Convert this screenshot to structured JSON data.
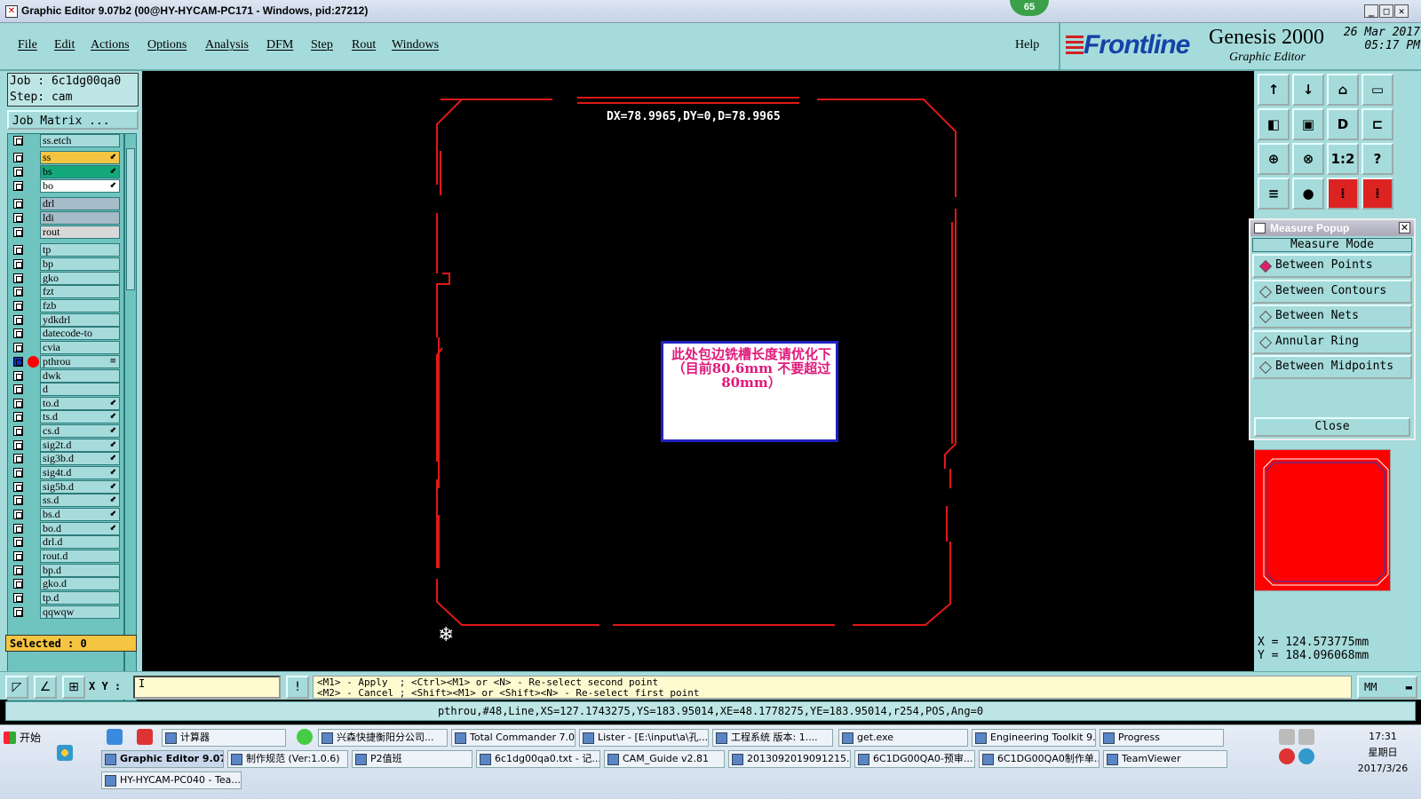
{
  "window": {
    "title": "Graphic Editor 9.07b2 (00@HY-HYCAM-PC171 - Windows, pid:27212)",
    "badge": "65",
    "min_glyph": "_",
    "max_glyph": "□",
    "close_glyph": "✕"
  },
  "menu": {
    "items": [
      "File",
      "Edit",
      "Actions",
      "Options",
      "Analysis",
      "DFM",
      "Step",
      "Rout",
      "Windows"
    ],
    "help": "Help"
  },
  "brand": {
    "logo": "Frontline",
    "product": "Genesis 2000",
    "subtitle": "Graphic Editor",
    "date": "26 Mar 2017",
    "time": "05:17 PM"
  },
  "job": {
    "job_line": "Job  :  6c1dg00qa0",
    "step_line": "Step:  cam",
    "matrix_button": "Job Matrix  ..."
  },
  "layers": [
    {
      "name": "ss.etch",
      "color": "#a6dbdb",
      "mark": ""
    },
    {
      "name": "ss",
      "color": "#f5c542",
      "mark": "⬋"
    },
    {
      "name": "bs",
      "color": "#15a87a",
      "mark": "⬋"
    },
    {
      "name": "bo",
      "color": "#ffffff",
      "mark": "⬋"
    },
    {
      "name": "drl",
      "color": "#a6bcc8",
      "mark": ""
    },
    {
      "name": "ldi",
      "color": "#a6bcc8",
      "mark": ""
    },
    {
      "name": "rout",
      "color": "#d8d8d8",
      "mark": ""
    },
    {
      "name": "tp",
      "color": "#a6dbdb",
      "mark": ""
    },
    {
      "name": "bp",
      "color": "#a6dbdb",
      "mark": ""
    },
    {
      "name": "gko",
      "color": "#a6dbdb",
      "mark": ""
    },
    {
      "name": "fzt",
      "color": "#a6dbdb",
      "mark": ""
    },
    {
      "name": "fzb",
      "color": "#a6dbdb",
      "mark": ""
    },
    {
      "name": "ydkdrl",
      "color": "#a6dbdb",
      "mark": ""
    },
    {
      "name": "datecode-to",
      "color": "#a6dbdb",
      "mark": ""
    },
    {
      "name": "cvia",
      "color": "#a6dbdb",
      "mark": ""
    },
    {
      "name": "pthrou",
      "color": "#a6dbdb",
      "mark": "≡"
    },
    {
      "name": "dwk",
      "color": "#a6dbdb",
      "mark": ""
    },
    {
      "name": "d",
      "color": "#a6dbdb",
      "mark": ""
    },
    {
      "name": "to.d",
      "color": "#a6dbdb",
      "mark": "⬋"
    },
    {
      "name": "ts.d",
      "color": "#a6dbdb",
      "mark": "⬋"
    },
    {
      "name": "cs.d",
      "color": "#a6dbdb",
      "mark": "⬋"
    },
    {
      "name": "sig2t.d",
      "color": "#a6dbdb",
      "mark": "⬋"
    },
    {
      "name": "sig3b.d",
      "color": "#a6dbdb",
      "mark": "⬋"
    },
    {
      "name": "sig4t.d",
      "color": "#a6dbdb",
      "mark": "⬋"
    },
    {
      "name": "sig5b.d",
      "color": "#a6dbdb",
      "mark": "⬋"
    },
    {
      "name": "ss.d",
      "color": "#a6dbdb",
      "mark": "⬋"
    },
    {
      "name": "bs.d",
      "color": "#a6dbdb",
      "mark": "⬋"
    },
    {
      "name": "bo.d",
      "color": "#a6dbdb",
      "mark": "⬋"
    },
    {
      "name": "drl.d",
      "color": "#a6dbdb",
      "mark": ""
    },
    {
      "name": "rout.d",
      "color": "#a6dbdb",
      "mark": ""
    },
    {
      "name": "bp.d",
      "color": "#a6dbdb",
      "mark": ""
    },
    {
      "name": "gko.d",
      "color": "#a6dbdb",
      "mark": ""
    },
    {
      "name": "tp.d",
      "color": "#a6dbdb",
      "mark": ""
    },
    {
      "name": "qqwqw",
      "color": "#a6dbdb",
      "mark": ""
    }
  ],
  "selected_text": "Selected : 0",
  "canvas": {
    "measure_readout": "DX=78.9965,DY=0,D=78.9965",
    "note_text": "此处包边铣槽长度请优化下（目前80.6mm   不要超过80mm）",
    "outline_color": "#e01818"
  },
  "toolbar": {
    "buttons": [
      "↑",
      "↓",
      "⌂",
      "▭",
      "◧",
      "▣",
      "D",
      "⊏",
      "⊕",
      "⊗",
      "1:2",
      "?",
      "≡",
      "●",
      "⁞",
      "⁞"
    ]
  },
  "measure_popup": {
    "title": "Measure Popup",
    "mode_label": "Measure Mode",
    "options": [
      {
        "label": "Between Points",
        "selected": true
      },
      {
        "label": "Between Contours",
        "selected": false
      },
      {
        "label": "Between Nets",
        "selected": false
      },
      {
        "label": "Annular Ring",
        "selected": false
      },
      {
        "label": "Between Midpoints",
        "selected": false
      }
    ],
    "close_label": "Close"
  },
  "coords": {
    "x": "X  =  124.573775mm",
    "y": "Y  =  184.096068mm"
  },
  "command": {
    "xy_label": "X Y :",
    "xy_value": "I",
    "hint_line1": "<M1> - Apply  ; <Ctrl><M1> or <N> - Re-select second point",
    "hint_line2": "<M2> - Cancel ; <Shift><M1> or <Shift><N> - Re-select first point",
    "unit": "MM"
  },
  "status": "pthrou,#48,Line,XS=127.1743275,YS=183.95014,XE=48.1778275,YE=183.95014,r254,POS,Ang=0",
  "taskbar": {
    "start": "开始",
    "row1": [
      "计算器",
      "兴森快捷衡阳分公司...",
      "Total Commander 7.0 ...",
      "Lister - [E:\\input\\a\\孔...",
      "工程系统  版本: 1....",
      "get.exe",
      "Engineering Toolkit 9....",
      "Progress"
    ],
    "row2": [
      "Graphic Editor 9.07...",
      "制作规范 (Ver:1.0.6)",
      "P2值班",
      "6c1dg00qa0.txt - 记...",
      "CAM_Guide v2.81",
      "2013092019091215....",
      "6C1DG00QA0-预审...",
      "6C1DG00QA0制作单...",
      "TeamViewer"
    ],
    "row3": [
      "HY-HYCAM-PC040 - Tea..."
    ],
    "clock": "17:31",
    "weekday": "星期日",
    "date": "2017/3/26"
  }
}
